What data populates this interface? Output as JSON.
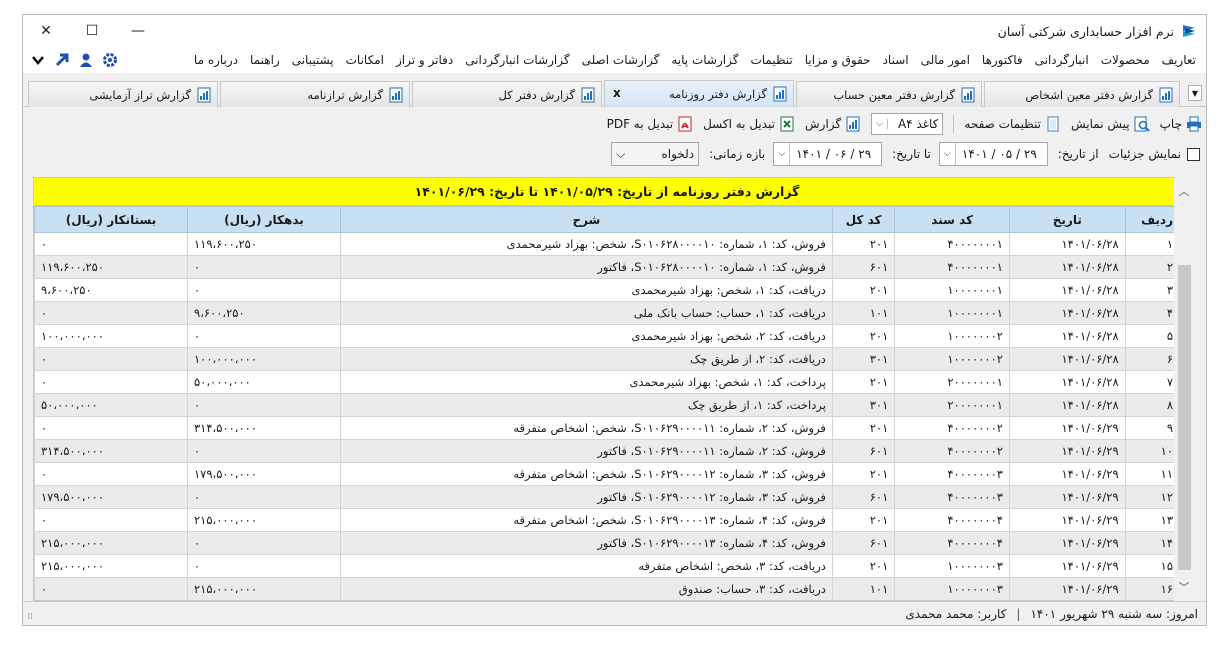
{
  "window": {
    "title": "نرم افزار حسابداری شرکتی آسان",
    "minimize": "—",
    "maximize": "☐",
    "close": "✕"
  },
  "menu": {
    "items": [
      "تعاریف",
      "محصولات",
      "انبارگردانی",
      "فاکتورها",
      "امور مالی",
      "اسناد",
      "حقوق و مزایا",
      "تنظیمات",
      "گزارشات پایه",
      "گزارشات اصلی",
      "گزارشات انبارگردانی",
      "دفاتر و تراز",
      "امکانات",
      "پشتیبانی",
      "راهنما",
      "درباره ما"
    ],
    "icons": [
      "gear-icon",
      "user-icon",
      "arrow-icon",
      "chevron-down-icon"
    ]
  },
  "tabs": [
    {
      "label": "گزارش دفتر معین اشخاص",
      "active": false
    },
    {
      "label": "گزارش دفتر معین حساب",
      "active": false
    },
    {
      "label": "گزارش دفتر روزنامه",
      "active": true,
      "close": "x"
    },
    {
      "label": "گزارش دفتر کل",
      "active": false
    },
    {
      "label": "گزارش ترازنامه",
      "active": false
    },
    {
      "label": "گزارش تراز آزمایشی",
      "active": false
    }
  ],
  "tab_dropdown": "▼",
  "toolbar": {
    "print": "چاپ",
    "preview": "پیش نمایش",
    "page_settings": "تنظیمات صفحه",
    "paper": "کاغذ A۴",
    "paper_arrow": "⌵",
    "report": "گزارش",
    "excel": "تبدیل به اکسل",
    "pdf": "تبدیل به PDF"
  },
  "filters": {
    "show_details": "نمایش جزئیات",
    "from_label": "از تاریخ:",
    "from_date": "۱۴۰۱ / ۰۵ / ۲۹",
    "to_label": "تا تاریخ:",
    "to_date": "۱۴۰۱ / ۰۶ / ۲۹",
    "period_label": "بازه زمانی:",
    "period_value": "دلخواه",
    "dd_arrow": "⌵"
  },
  "report": {
    "title": "گزارش دفتر روزنامه از تاریخ: ۱۴۰۱/۰۵/۲۹ تا تاریخ: ۱۴۰۱/۰۶/۲۹",
    "columns": [
      "ردیف",
      "تاریخ",
      "کد سند",
      "کد کل",
      "شرح",
      "بدهکار (ریال)",
      "بستانکار (ریال)"
    ],
    "rows": [
      [
        "۱",
        "۱۴۰۱/۰۶/۲۸",
        "۴۰۰۰۰۰۰۰۱",
        "۲۰۱",
        "فروش، کد: ۱، شماره: S۰۱۰۶۲۸۰۰۰۰۱۰، شخص: بهزاد شیرمحمدی",
        "۱۱۹،۶۰۰،۲۵۰",
        "۰"
      ],
      [
        "۲",
        "۱۴۰۱/۰۶/۲۸",
        "۴۰۰۰۰۰۰۰۱",
        "۶۰۱",
        "فروش، کد: ۱، شماره: S۰۱۰۶۲۸۰۰۰۰۱۰، فاکتور",
        "۰",
        "۱۱۹،۶۰۰،۲۵۰"
      ],
      [
        "۳",
        "۱۴۰۱/۰۶/۲۸",
        "۱۰۰۰۰۰۰۰۱",
        "۲۰۱",
        "دریافت، کد: ۱، شخص: بهزاد شیرمحمدی",
        "۰",
        "۹،۶۰۰،۲۵۰"
      ],
      [
        "۴",
        "۱۴۰۱/۰۶/۲۸",
        "۱۰۰۰۰۰۰۰۱",
        "۱۰۱",
        "دریافت، کد: ۱، حساب: حساب بانک ملی",
        "۹،۶۰۰،۲۵۰",
        "۰"
      ],
      [
        "۵",
        "۱۴۰۱/۰۶/۲۸",
        "۱۰۰۰۰۰۰۰۲",
        "۲۰۱",
        "دریافت، کد: ۲، شخص: بهزاد شیرمحمدی",
        "۰",
        "۱۰۰،۰۰۰،۰۰۰"
      ],
      [
        "۶",
        "۱۴۰۱/۰۶/۲۸",
        "۱۰۰۰۰۰۰۰۲",
        "۳۰۱",
        "دریافت، کد: ۲، از طریق چک",
        "۱۰۰،۰۰۰،۰۰۰",
        "۰"
      ],
      [
        "۷",
        "۱۴۰۱/۰۶/۲۸",
        "۲۰۰۰۰۰۰۰۱",
        "۲۰۱",
        "پرداخت، کد: ۱، شخص: بهزاد شیرمحمدی",
        "۵۰،۰۰۰،۰۰۰",
        "۰"
      ],
      [
        "۸",
        "۱۴۰۱/۰۶/۲۸",
        "۲۰۰۰۰۰۰۰۱",
        "۳۰۱",
        "پرداخت، کد: ۱، از طریق چک",
        "۰",
        "۵۰،۰۰۰،۰۰۰"
      ],
      [
        "۹",
        "۱۴۰۱/۰۶/۲۹",
        "۴۰۰۰۰۰۰۰۲",
        "۲۰۱",
        "فروش، کد: ۲، شماره: S۰۱۰۶۲۹۰۰۰۰۱۱، شخص: اشخاص متفرقه",
        "۳۱۴،۵۰۰،۰۰۰",
        "۰"
      ],
      [
        "۱۰",
        "۱۴۰۱/۰۶/۲۹",
        "۴۰۰۰۰۰۰۰۲",
        "۶۰۱",
        "فروش، کد: ۲، شماره: S۰۱۰۶۲۹۰۰۰۰۱۱، فاکتور",
        "۰",
        "۳۱۴،۵۰۰،۰۰۰"
      ],
      [
        "۱۱",
        "۱۴۰۱/۰۶/۲۹",
        "۴۰۰۰۰۰۰۰۳",
        "۲۰۱",
        "فروش، کد: ۳، شماره: S۰۱۰۶۲۹۰۰۰۰۱۲، شخص: اشخاص متفرقه",
        "۱۷۹،۵۰۰،۰۰۰",
        "۰"
      ],
      [
        "۱۲",
        "۱۴۰۱/۰۶/۲۹",
        "۴۰۰۰۰۰۰۰۳",
        "۶۰۱",
        "فروش، کد: ۳، شماره: S۰۱۰۶۲۹۰۰۰۰۱۲، فاکتور",
        "۰",
        "۱۷۹،۵۰۰،۰۰۰"
      ],
      [
        "۱۳",
        "۱۴۰۱/۰۶/۲۹",
        "۴۰۰۰۰۰۰۰۴",
        "۲۰۱",
        "فروش، کد: ۴، شماره: S۰۱۰۶۲۹۰۰۰۰۱۳، شخص: اشخاص متفرقه",
        "۲۱۵،۰۰۰،۰۰۰",
        "۰"
      ],
      [
        "۱۴",
        "۱۴۰۱/۰۶/۲۹",
        "۴۰۰۰۰۰۰۰۴",
        "۶۰۱",
        "فروش، کد: ۴، شماره: S۰۱۰۶۲۹۰۰۰۰۱۳، فاکتور",
        "۰",
        "۲۱۵،۰۰۰،۰۰۰"
      ],
      [
        "۱۵",
        "۱۴۰۱/۰۶/۲۹",
        "۱۰۰۰۰۰۰۰۳",
        "۲۰۱",
        "دریافت، کد: ۳، شخص: اشخاص متفرقه",
        "۰",
        "۲۱۵،۰۰۰،۰۰۰"
      ],
      [
        "۱۶",
        "۱۴۰۱/۰۶/۲۹",
        "۱۰۰۰۰۰۰۰۳",
        "۱۰۱",
        "دریافت، کد: ۳، حساب: صندوق",
        "۲۱۵،۰۰۰،۰۰۰",
        "۰"
      ]
    ]
  },
  "scroll": {
    "up": "︿",
    "down": "﹀"
  },
  "status": {
    "today": "امروز: سه شنبه ۲۹ شهریور ۱۴۰۱",
    "separator": "|",
    "user": "کاربر: محمد محمدی"
  },
  "colors": {
    "report_title_bg": "#ffff00",
    "header_bg": "#c7e0f4",
    "accent": "#1f6fc2"
  }
}
